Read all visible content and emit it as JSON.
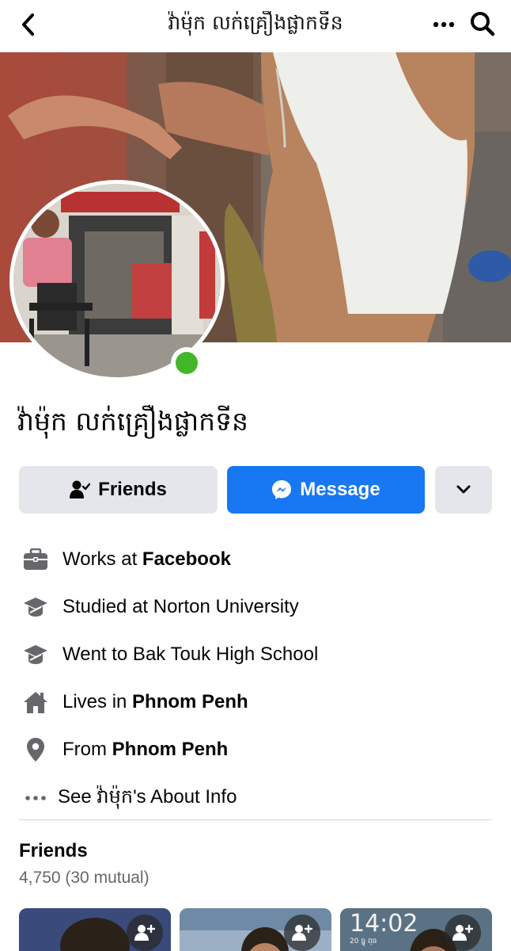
{
  "header": {
    "title": "វ៉ាម៉ុក លក់គ្រឿងផ្លាកទីន",
    "back_icon": "chevron-left-icon",
    "more_icon": "more-horizontal-icon",
    "search_icon": "search-icon"
  },
  "profile": {
    "name": "វ៉ាម៉ុក លក់គ្រឿងផ្លាកទីន",
    "online": true,
    "online_color": "#42b72a"
  },
  "actions": {
    "friends_label": "Friends",
    "message_label": "Message",
    "message_color": "#1877f2"
  },
  "details": [
    {
      "icon": "briefcase-icon",
      "prefix": "Works at ",
      "bold": "Facebook",
      "suffix": ""
    },
    {
      "icon": "graduation-cap-icon",
      "prefix": "Studied at Norton University",
      "bold": "",
      "suffix": ""
    },
    {
      "icon": "graduation-cap-icon",
      "prefix": "Went to Bak Touk High School",
      "bold": "",
      "suffix": ""
    },
    {
      "icon": "home-icon",
      "prefix": "Lives in ",
      "bold": "Phnom Penh",
      "suffix": ""
    },
    {
      "icon": "location-pin-icon",
      "prefix": "From ",
      "bold": "Phnom Penh",
      "suffix": ""
    }
  ],
  "see_about": "See វ៉ាម៉ុក's About Info",
  "friends": {
    "title": "Friends",
    "count": "4,750 (30 mutual)",
    "thumbs": [
      {
        "time": "",
        "date": ""
      },
      {
        "time": "",
        "date": ""
      },
      {
        "time": "14:02",
        "date": "20 ធ្នូ ពុធ"
      }
    ]
  }
}
